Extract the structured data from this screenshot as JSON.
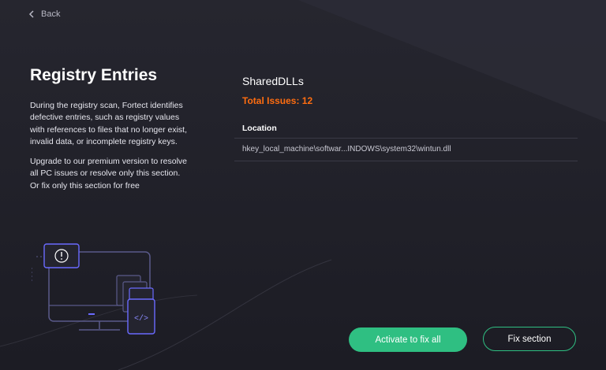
{
  "nav": {
    "back_label": "Back"
  },
  "left": {
    "title": "Registry Entries",
    "description_1": "During the registry scan, Fortect identifies defective entries, such as registry values with references to files that no longer exist, invalid data, or incomplete registry keys.",
    "description_2a": "Upgrade to our premium version to resolve all PC issues or resolve only this section.",
    "description_2b": "Or fix only this section for free"
  },
  "main": {
    "section_name": "SharedDLLs",
    "total_issues": "Total Issues: 12",
    "column_header": "Location",
    "rows": [
      {
        "location": "hkey_local_machine\\softwar...INDOWS\\system32\\wintun.dll"
      }
    ]
  },
  "actions": {
    "activate_label": "Activate to fix all",
    "fix_section_label": "Fix section"
  },
  "colors": {
    "accent": "#2fbf82",
    "warning": "#ff6d10",
    "background": "#24242f"
  }
}
